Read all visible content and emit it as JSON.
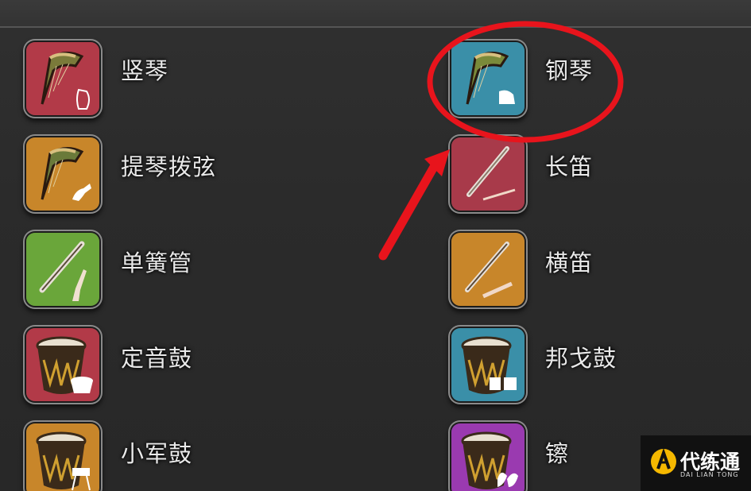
{
  "instruments": [
    {
      "label": "竖琴",
      "icon": "harp-icon",
      "bg": "#b23a48"
    },
    {
      "label": "钢琴",
      "icon": "piano-harp-icon",
      "bg": "#3a8fa8"
    },
    {
      "label": "提琴拨弦",
      "icon": "pizzicato-harp-icon",
      "bg": "#c8862a"
    },
    {
      "label": "长笛",
      "icon": "flute-icon",
      "bg": "#a83a4a"
    },
    {
      "label": "单簧管",
      "icon": "clarinet-icon",
      "bg": "#6aa63a"
    },
    {
      "label": "横笛",
      "icon": "fife-icon",
      "bg": "#c8862a"
    },
    {
      "label": "定音鼓",
      "icon": "timpani-icon",
      "bg": "#b23a48"
    },
    {
      "label": "邦戈鼓",
      "icon": "bongo-icon",
      "bg": "#3a8fa8"
    },
    {
      "label": "小军鼓",
      "icon": "snare-drum-icon",
      "bg": "#c8862a"
    },
    {
      "label": "镲",
      "icon": "cymbal-icon",
      "bg": "#9a3ab0"
    }
  ],
  "annotation": {
    "color": "#e8141c"
  },
  "watermark": {
    "name": "代练通",
    "sub": "DAI LIAN TONG",
    "color": "#f5b800"
  }
}
